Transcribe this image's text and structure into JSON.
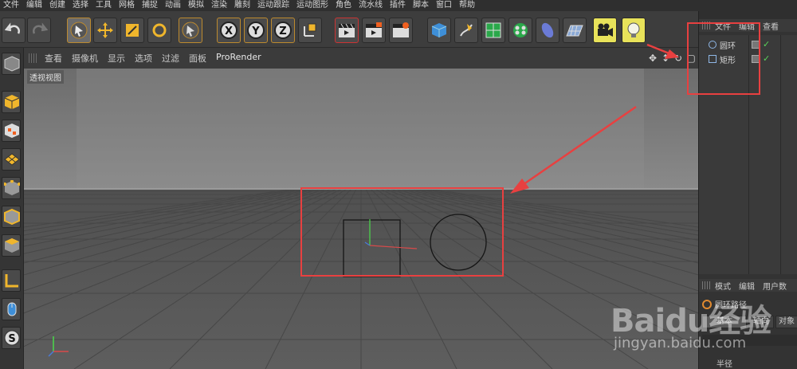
{
  "menu": [
    "文件",
    "编辑",
    "创建",
    "选择",
    "工具",
    "网格",
    "捕捉",
    "动画",
    "模拟",
    "渲染",
    "雕刻",
    "运动跟踪",
    "运动图形",
    "角色",
    "流水线",
    "插件",
    "脚本",
    "窗口",
    "帮助"
  ],
  "viewport": {
    "menu": [
      "查看",
      "摄像机",
      "显示",
      "选项",
      "过滤",
      "面板",
      "ProRender"
    ],
    "label": "透视视图"
  },
  "objects_panel": {
    "menu": [
      "文件",
      "编辑",
      "查看"
    ],
    "items": [
      {
        "label": "圆环",
        "icon": "circle-spline-icon"
      },
      {
        "label": "矩形",
        "icon": "rectangle-spline-icon"
      }
    ]
  },
  "attributes_panel": {
    "menu": [
      "模式",
      "编辑",
      "用户数"
    ],
    "object_title": "圆环路径",
    "tabs": [
      "基本",
      "轴向",
      "对象"
    ],
    "field_label": "半径"
  },
  "watermark": {
    "logo": "Baidu经验",
    "url": "jingyan.baidu.com"
  },
  "colors": {
    "accent_red": "#e84040",
    "selected_tool": "#e8e25a",
    "x_axis": "#d94a4a",
    "y_axis": "#4ad94a",
    "z_axis": "#4a7ad9"
  }
}
